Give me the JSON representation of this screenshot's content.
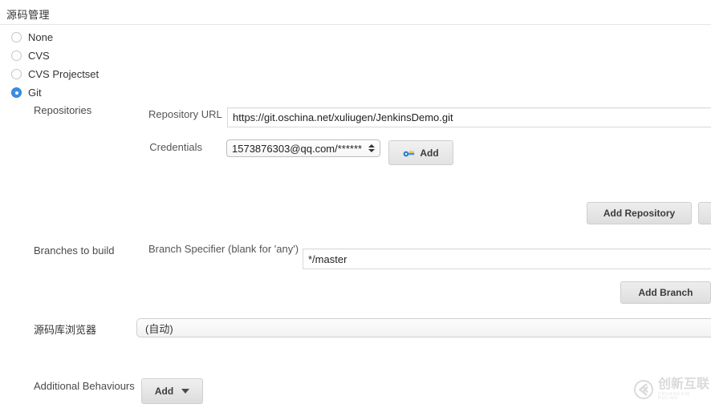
{
  "section": {
    "title": "源码管理"
  },
  "scm_options": [
    {
      "label": "None",
      "selected": false
    },
    {
      "label": "CVS",
      "selected": false
    },
    {
      "label": "CVS Projectset",
      "selected": false
    },
    {
      "label": "Git",
      "selected": true
    }
  ],
  "repositories": {
    "label": "Repositories",
    "url_label": "Repository URL",
    "url_value": "https://git.oschina.net/xuliugen/JenkinsDemo.git",
    "credentials_label": "Credentials",
    "credentials_value": "1573876303@qq.com/******",
    "add_credentials_label": "Add",
    "add_credentials_icon": "key-icon",
    "add_repository_label": "Add Repository"
  },
  "branches": {
    "label": "Branches to build",
    "specifier_label": "Branch Specifier (blank for 'any')",
    "specifier_value": "*/master",
    "add_branch_label": "Add Branch"
  },
  "repo_browser": {
    "label": "源码库浏览器",
    "value": "(自动)"
  },
  "additional_behaviours": {
    "label": "Additional Behaviours",
    "add_label": "Add",
    "caret_icon": "chevron-down-icon"
  },
  "watermark": {
    "cn": "创新互联",
    "en": "CHUANGXIN HULIAN"
  },
  "colors": {
    "accent": "#3b8fe5",
    "text": "#333333",
    "border": "#d9d9d9",
    "button_face": "#e8e8e8"
  }
}
